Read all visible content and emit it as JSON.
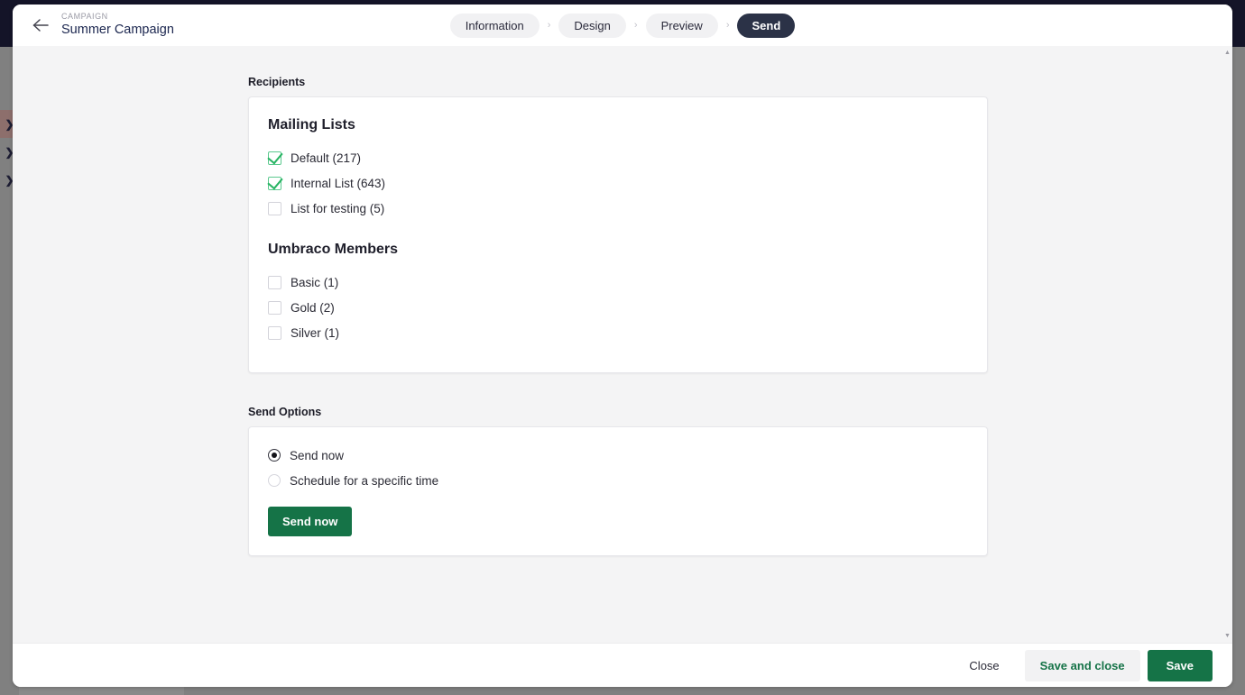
{
  "colors": {
    "backdrop": "#808080",
    "dark_band": "#141428",
    "accent_green": "#157347",
    "check_green": "#28b463",
    "active_tab": "#2b3247",
    "content_bg": "#f4f4f5",
    "sidebar_highlight": "#8d6f6c"
  },
  "sidebar": {
    "rows": [
      {
        "icon": "chevron-right-icon",
        "glyph": "❯",
        "highlighted": true
      },
      {
        "icon": "chevron-right-icon",
        "glyph": "❯",
        "highlighted": false
      },
      {
        "icon": "chevron-right-icon",
        "glyph": "❯",
        "highlighted": false
      }
    ]
  },
  "header": {
    "back_icon": "arrow-left-icon",
    "eyebrow": "CAMPAIGN",
    "title": "Summer Campaign",
    "tabs": [
      {
        "label": "Information",
        "active": false
      },
      {
        "label": "Design",
        "active": false
      },
      {
        "label": "Preview",
        "active": false
      },
      {
        "label": "Send",
        "active": true
      }
    ],
    "tab_separator": "›"
  },
  "main": {
    "recipients": {
      "section_label": "Recipients",
      "groups": [
        {
          "heading": "Mailing Lists",
          "items": [
            {
              "label": "Default (217)",
              "checked": true
            },
            {
              "label": "Internal List (643)",
              "checked": true
            },
            {
              "label": "List for testing (5)",
              "checked": false
            }
          ]
        },
        {
          "heading": "Umbraco Members",
          "items": [
            {
              "label": "Basic (1)",
              "checked": false
            },
            {
              "label": "Gold (2)",
              "checked": false
            },
            {
              "label": "Silver (1)",
              "checked": false
            }
          ]
        }
      ]
    },
    "send_options": {
      "section_label": "Send Options",
      "radios": [
        {
          "label": "Send now",
          "selected": true
        },
        {
          "label": "Schedule for a specific time",
          "selected": false
        }
      ],
      "action_label": "Send now"
    }
  },
  "scrollbar": {
    "up_arrow_icon": "caret-up-icon",
    "up_glyph": "▲",
    "down_arrow_icon": "caret-down-icon",
    "down_glyph": "▼"
  },
  "footer": {
    "close_label": "Close",
    "save_and_close_label": "Save and close",
    "save_label": "Save"
  }
}
